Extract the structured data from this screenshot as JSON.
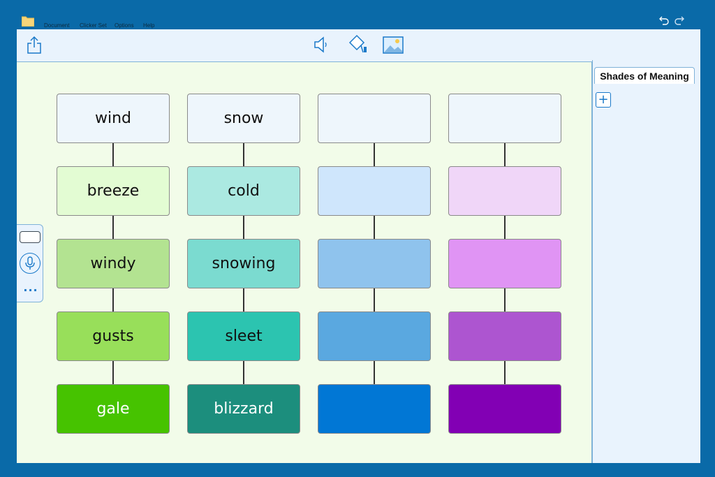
{
  "menu": {
    "items": [
      "Document",
      "Clicker Set",
      "Options",
      "Help"
    ]
  },
  "toolbar": {
    "icons": [
      "share-icon",
      "speaker-icon",
      "paint-bucket-icon",
      "image-icon"
    ]
  },
  "colors": {
    "frame": "#0a6aa8",
    "canvas": "#f2fce9",
    "accent": "#1a79c9"
  },
  "grid": {
    "columns": [
      {
        "cells": [
          {
            "label": "wind",
            "color": "#eef6fc"
          },
          {
            "label": "breeze",
            "color": "#e3fcd3"
          },
          {
            "label": "windy",
            "color": "#b3e391"
          },
          {
            "label": "gusts",
            "color": "#98df5a"
          },
          {
            "label": "gale",
            "color": "#46c300",
            "light": true
          }
        ]
      },
      {
        "cells": [
          {
            "label": "snow",
            "color": "#eef6fc"
          },
          {
            "label": "cold",
            "color": "#abe9e1"
          },
          {
            "label": "snowing",
            "color": "#7bdbd0"
          },
          {
            "label": "sleet",
            "color": "#2cc4b0"
          },
          {
            "label": "blizzard",
            "color": "#1c8e7d",
            "light": true
          }
        ]
      },
      {
        "cells": [
          {
            "label": "",
            "color": "#eef6fc"
          },
          {
            "label": "",
            "color": "#cfe6fc"
          },
          {
            "label": "",
            "color": "#8fc3ed"
          },
          {
            "label": "",
            "color": "#5aa8e0"
          },
          {
            "label": "",
            "color": "#0177d5"
          }
        ]
      },
      {
        "cells": [
          {
            "label": "",
            "color": "#eef6fc"
          },
          {
            "label": "",
            "color": "#f0d6f8"
          },
          {
            "label": "",
            "color": "#e094f4"
          },
          {
            "label": "",
            "color": "#ad55d0"
          },
          {
            "label": "",
            "color": "#8200b4"
          }
        ]
      }
    ]
  },
  "panel": {
    "tab_label": "Shades of Meaning",
    "add_label": "+"
  },
  "side": {
    "more_label": "..."
  }
}
